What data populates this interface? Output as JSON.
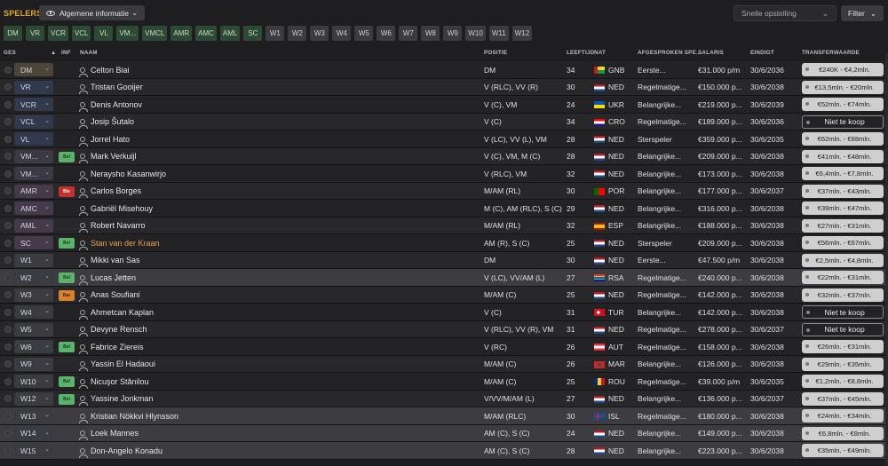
{
  "header": {
    "title": "SPELERS",
    "view_label": "Algemene informatie",
    "quick_select_label": "Snelle opstelling",
    "filter_label": "Filter"
  },
  "position_chips": [
    {
      "label": "DM",
      "group": "green"
    },
    {
      "label": "VR",
      "group": "green"
    },
    {
      "label": "VCR",
      "group": "green"
    },
    {
      "label": "VCL",
      "group": "green"
    },
    {
      "label": "VL",
      "group": "green"
    },
    {
      "label": "VM...",
      "group": "green"
    },
    {
      "label": "VMCL",
      "group": "green"
    },
    {
      "label": "AMR",
      "group": "green"
    },
    {
      "label": "AMC",
      "group": "green"
    },
    {
      "label": "AML",
      "group": "green"
    },
    {
      "label": "SC",
      "group": "green"
    },
    {
      "label": "W1",
      "group": "grey"
    },
    {
      "label": "W2",
      "group": "grey"
    },
    {
      "label": "W3",
      "group": "grey"
    },
    {
      "label": "W4",
      "group": "grey"
    },
    {
      "label": "W5",
      "group": "grey"
    },
    {
      "label": "W6",
      "group": "grey"
    },
    {
      "label": "W7",
      "group": "grey"
    },
    {
      "label": "W8",
      "group": "grey"
    },
    {
      "label": "W9",
      "group": "grey"
    },
    {
      "label": "W10",
      "group": "grey"
    },
    {
      "label": "W11",
      "group": "grey"
    },
    {
      "label": "W12",
      "group": "grey"
    }
  ],
  "columns": {
    "ges": "GES",
    "inf": "INF",
    "naam": "NAAM",
    "positie": "POSITIE",
    "leeftijd": "LEEFTIJD",
    "nat": "NAT",
    "afgesproken": "AFGESPROKEN SPE...",
    "salaris": "SALARIS",
    "eindigt": "EINDIGT",
    "transfer": "TRANSFERWAARDE"
  },
  "players": [
    {
      "slot": "DM",
      "slot_type": "gk",
      "inf": "",
      "name": "Celton Biai",
      "position": "DM",
      "age": "34",
      "nat": "GNB",
      "role": "Eerste...",
      "salary": "€31.000 p/m",
      "ends": "30/6/2036",
      "value": "€240K - €4,2mln."
    },
    {
      "slot": "VR",
      "slot_type": "def",
      "inf": "",
      "name": "Tristan Gooijer",
      "position": "V (RLC), VV (R)",
      "age": "30",
      "nat": "NED",
      "role": "Regelmatige...",
      "salary": "€150.000 p...",
      "ends": "30/6/2038",
      "value": "€13,5mln. - €20mln."
    },
    {
      "slot": "VCR",
      "slot_type": "def",
      "inf": "",
      "name": "Denis Antonov",
      "position": "V (C), VM",
      "age": "24",
      "nat": "UKR",
      "role": "Belangrijke...",
      "salary": "€219.000 p...",
      "ends": "30/6/2039",
      "value": "€52mln. - €74mln."
    },
    {
      "slot": "VCL",
      "slot_type": "def",
      "inf": "",
      "name": "Josip Šutalo",
      "position": "V (C)",
      "age": "34",
      "nat": "CRO",
      "role": "Regelmatige...",
      "salary": "€189.000 p...",
      "ends": "30/6/2036",
      "value": "Niet te koop"
    },
    {
      "slot": "VL",
      "slot_type": "def",
      "inf": "",
      "name": "Jorrel Hato",
      "position": "V (LC), VV (L), VM",
      "age": "28",
      "nat": "NED",
      "role": "Sterspeler",
      "salary": "€359.000 p...",
      "ends": "30/6/2035",
      "value": "€62mln. - €88mln."
    },
    {
      "slot": "VM...",
      "slot_type": "wm",
      "inf": "Bel",
      "inf_color": "g",
      "name": "Mark Verkuijl",
      "position": "V (C), VM, M (C)",
      "age": "28",
      "nat": "NED",
      "role": "Belangrijke...",
      "salary": "€209.000 p...",
      "ends": "30/6/2038",
      "value": "€41mln. - €48mln."
    },
    {
      "slot": "VM...",
      "slot_type": "wm",
      "inf": "",
      "name": "Neraysho Kasanwirjo",
      "position": "V (RLC), VM",
      "age": "32",
      "nat": "NED",
      "role": "Belangrijke...",
      "salary": "€173.000 p...",
      "ends": "30/6/2038",
      "value": "€6,4mln. - €7,8mln."
    },
    {
      "slot": "AMR",
      "slot_type": "att",
      "inf": "Ble",
      "inf_color": "r",
      "name": "Carlos Borges",
      "position": "M/AM (RL)",
      "age": "30",
      "nat": "POR",
      "role": "Belangrijke...",
      "salary": "€177.000 p...",
      "ends": "30/6/2037",
      "value": "€37mln. - €43mln."
    },
    {
      "slot": "AMC",
      "slot_type": "att",
      "inf": "",
      "name": "Gabriël Misehouy",
      "position": "M (C), AM (RLC), S (C)",
      "age": "29",
      "nat": "NED",
      "role": "Belangrijke...",
      "salary": "€316.000 p...",
      "ends": "30/6/2038",
      "value": "€39mln. - €47mln."
    },
    {
      "slot": "AML",
      "slot_type": "att",
      "inf": "",
      "name": "Robert Navarro",
      "position": "M/AM (RL)",
      "age": "32",
      "nat": "ESP",
      "role": "Belangrijke...",
      "salary": "€188.000 p...",
      "ends": "30/6/2038",
      "value": "€27mln. - €31mln."
    },
    {
      "slot": "SC",
      "slot_type": "att",
      "inf": "Bel",
      "inf_color": "g",
      "name": "Stan van der Kraan",
      "highlight": true,
      "position": "AM (R), S (C)",
      "age": "25",
      "nat": "NED",
      "role": "Sterspeler",
      "salary": "€209.000 p...",
      "ends": "30/6/2038",
      "value": "€56mln. - €67mln."
    },
    {
      "slot": "W1",
      "slot_type": "sub",
      "inf": "",
      "name": "Mikki van Sas",
      "position": "DM",
      "age": "30",
      "nat": "NED",
      "role": "Eerste...",
      "salary": "€47.500 p/m",
      "ends": "30/6/2038",
      "value": "€2,5mln. - €4,8mln."
    },
    {
      "slot": "W2",
      "slot_type": "sub",
      "inf": "Bel",
      "inf_color": "g",
      "name": "Lucas Jetten",
      "position": "V (LC), VV/AM (L)",
      "age": "27",
      "nat": "RSA",
      "role": "Regelmatige...",
      "salary": "€240.000 p...",
      "ends": "30/6/2038",
      "value": "€22mln. - €31mln.",
      "selected": true
    },
    {
      "slot": "W3",
      "slot_type": "sub",
      "inf": "Bar",
      "inf_color": "o",
      "name": "Anas Soufiani",
      "position": "M/AM (C)",
      "age": "25",
      "nat": "NED",
      "role": "Regelmatige...",
      "salary": "€142.000 p...",
      "ends": "30/6/2038",
      "value": "€32mln. - €37mln."
    },
    {
      "slot": "W4",
      "slot_type": "sub",
      "inf": "",
      "name": "Ahmetcan Kaplan",
      "position": "V (C)",
      "age": "31",
      "nat": "TUR",
      "role": "Belangrijke...",
      "salary": "€142.000 p...",
      "ends": "30/6/2038",
      "value": "Niet te koop"
    },
    {
      "slot": "W5",
      "slot_type": "sub",
      "inf": "",
      "name": "Devyne Rensch",
      "position": "V (RLC), VV (R), VM",
      "age": "31",
      "nat": "NED",
      "role": "Regelmatige...",
      "salary": "€278.000 p...",
      "ends": "30/6/2037",
      "value": "Niet te koop"
    },
    {
      "slot": "W6",
      "slot_type": "sub",
      "inf": "Bel",
      "inf_color": "g",
      "name": "Fabrice Ziereis",
      "position": "V (RC)",
      "age": "26",
      "nat": "AUT",
      "role": "Regelmatige...",
      "salary": "€158.000 p...",
      "ends": "30/6/2038",
      "value": "€26mln. - €31mln."
    },
    {
      "slot": "W9",
      "slot_type": "sub",
      "inf": "",
      "name": "Yassin El Hadaoui",
      "position": "M/AM (C)",
      "age": "26",
      "nat": "MAR",
      "role": "Belangrijke...",
      "salary": "€126.000 p...",
      "ends": "30/6/2038",
      "value": "€29mln. - €35mln."
    },
    {
      "slot": "W10",
      "slot_type": "sub",
      "inf": "Bel",
      "inf_color": "g",
      "name": "Nicuşor Stănilou",
      "position": "M/AM (C)",
      "age": "25",
      "nat": "ROU",
      "role": "Regelmatige...",
      "salary": "€39.000 p/m",
      "ends": "30/6/2035",
      "value": "€1,2mln. - €8,8mln."
    },
    {
      "slot": "W12",
      "slot_type": "sub",
      "inf": "Bel",
      "inf_color": "g",
      "name": "Yassine Jonkman",
      "position": "V/VV/M/AM (L)",
      "age": "27",
      "nat": "NED",
      "role": "Belangrijke...",
      "salary": "€136.000 p...",
      "ends": "30/6/2037",
      "value": "€37mln. - €45mln."
    },
    {
      "slot": "W13",
      "slot_type": "sub",
      "inf": "",
      "name": "Kristian Nökkvi Hlynsson",
      "position": "M/AM (RLC)",
      "age": "30",
      "nat": "ISL",
      "role": "Regelmatige...",
      "salary": "€180.000 p...",
      "ends": "30/6/2038",
      "value": "€24mln. - €34mln.",
      "selected": true
    },
    {
      "slot": "W14",
      "slot_type": "sub",
      "inf": "",
      "name": "Loek Mannes",
      "position": "AM (C), S (C)",
      "age": "24",
      "nat": "NED",
      "role": "Belangrijke...",
      "salary": "€149.000 p...",
      "ends": "30/6/2038",
      "value": "€6,8mln. - €8mln.",
      "selected": true
    },
    {
      "slot": "W15",
      "slot_type": "sub",
      "inf": "",
      "name": "Don-Angelo Konadu",
      "position": "AM (C), S (C)",
      "age": "28",
      "nat": "NED",
      "role": "Belangrijke...",
      "salary": "€223.000 p...",
      "ends": "30/6/2038",
      "value": "€35mln. - €49mln.",
      "selected": true
    }
  ],
  "colors": {
    "accent": "#e0a818",
    "chip_green": "#2d4a34",
    "highlight_name": "#e8a04a",
    "bel_badge": "#5bb26a",
    "ble_badge": "#c0332d",
    "bar_badge": "#d9822b"
  },
  "icons": {
    "view": "eye-icon",
    "dropdown": "chevron-down-icon",
    "manager": "person-icon",
    "sort": "sort-arrow-icon"
  }
}
